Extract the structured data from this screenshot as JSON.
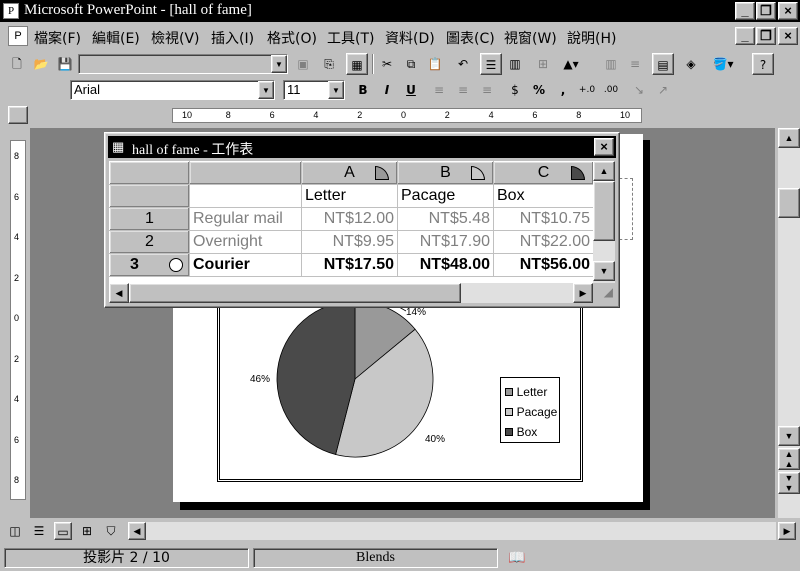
{
  "window": {
    "title": "Microsoft PowerPoint - [hall of fame]"
  },
  "menu": [
    "檔案(F)",
    "編輯(E)",
    "檢視(V)",
    "插入(I)",
    "格式(O)",
    "工具(T)",
    "資料(D)",
    "圖表(C)",
    "視窗(W)",
    "說明(H)"
  ],
  "formatting": {
    "font": "Arial",
    "size": "11"
  },
  "ruler_labels": [
    "10",
    "8",
    "6",
    "4",
    "2",
    "0",
    "2",
    "4",
    "6",
    "8",
    "10"
  ],
  "vruler_labels": [
    "8",
    "6",
    "4",
    "2",
    "0",
    "2",
    "4",
    "6",
    "8"
  ],
  "sheet": {
    "title": "hall of fame - 工作表",
    "columns": [
      "A",
      "B",
      "C"
    ],
    "headers": [
      "Letter",
      "Pacage",
      "Box"
    ],
    "rows": [
      {
        "num": "1",
        "label": "Regular mail",
        "values": [
          "NT$12.00",
          "NT$5.48",
          "NT$10.75"
        ],
        "dim": true
      },
      {
        "num": "2",
        "label": "Overnight",
        "values": [
          "NT$9.95",
          "NT$17.90",
          "NT$22.00"
        ],
        "dim": true
      },
      {
        "num": "3",
        "label": "Courier",
        "values": [
          "NT$17.50",
          "NT$48.00",
          "NT$56.00"
        ],
        "dim": false
      }
    ]
  },
  "chart_data": {
    "type": "pie",
    "labels": [
      "Letter",
      "Pacage",
      "Box"
    ],
    "values": [
      14,
      40,
      46
    ],
    "value_labels": [
      "14%",
      "40%",
      "46%"
    ],
    "colors": [
      "#999999",
      "#c8c8c8",
      "#4a4a4a"
    ],
    "legend_position": "right"
  },
  "status": {
    "slide": "投影片 2 / 10",
    "design": "Blends"
  }
}
